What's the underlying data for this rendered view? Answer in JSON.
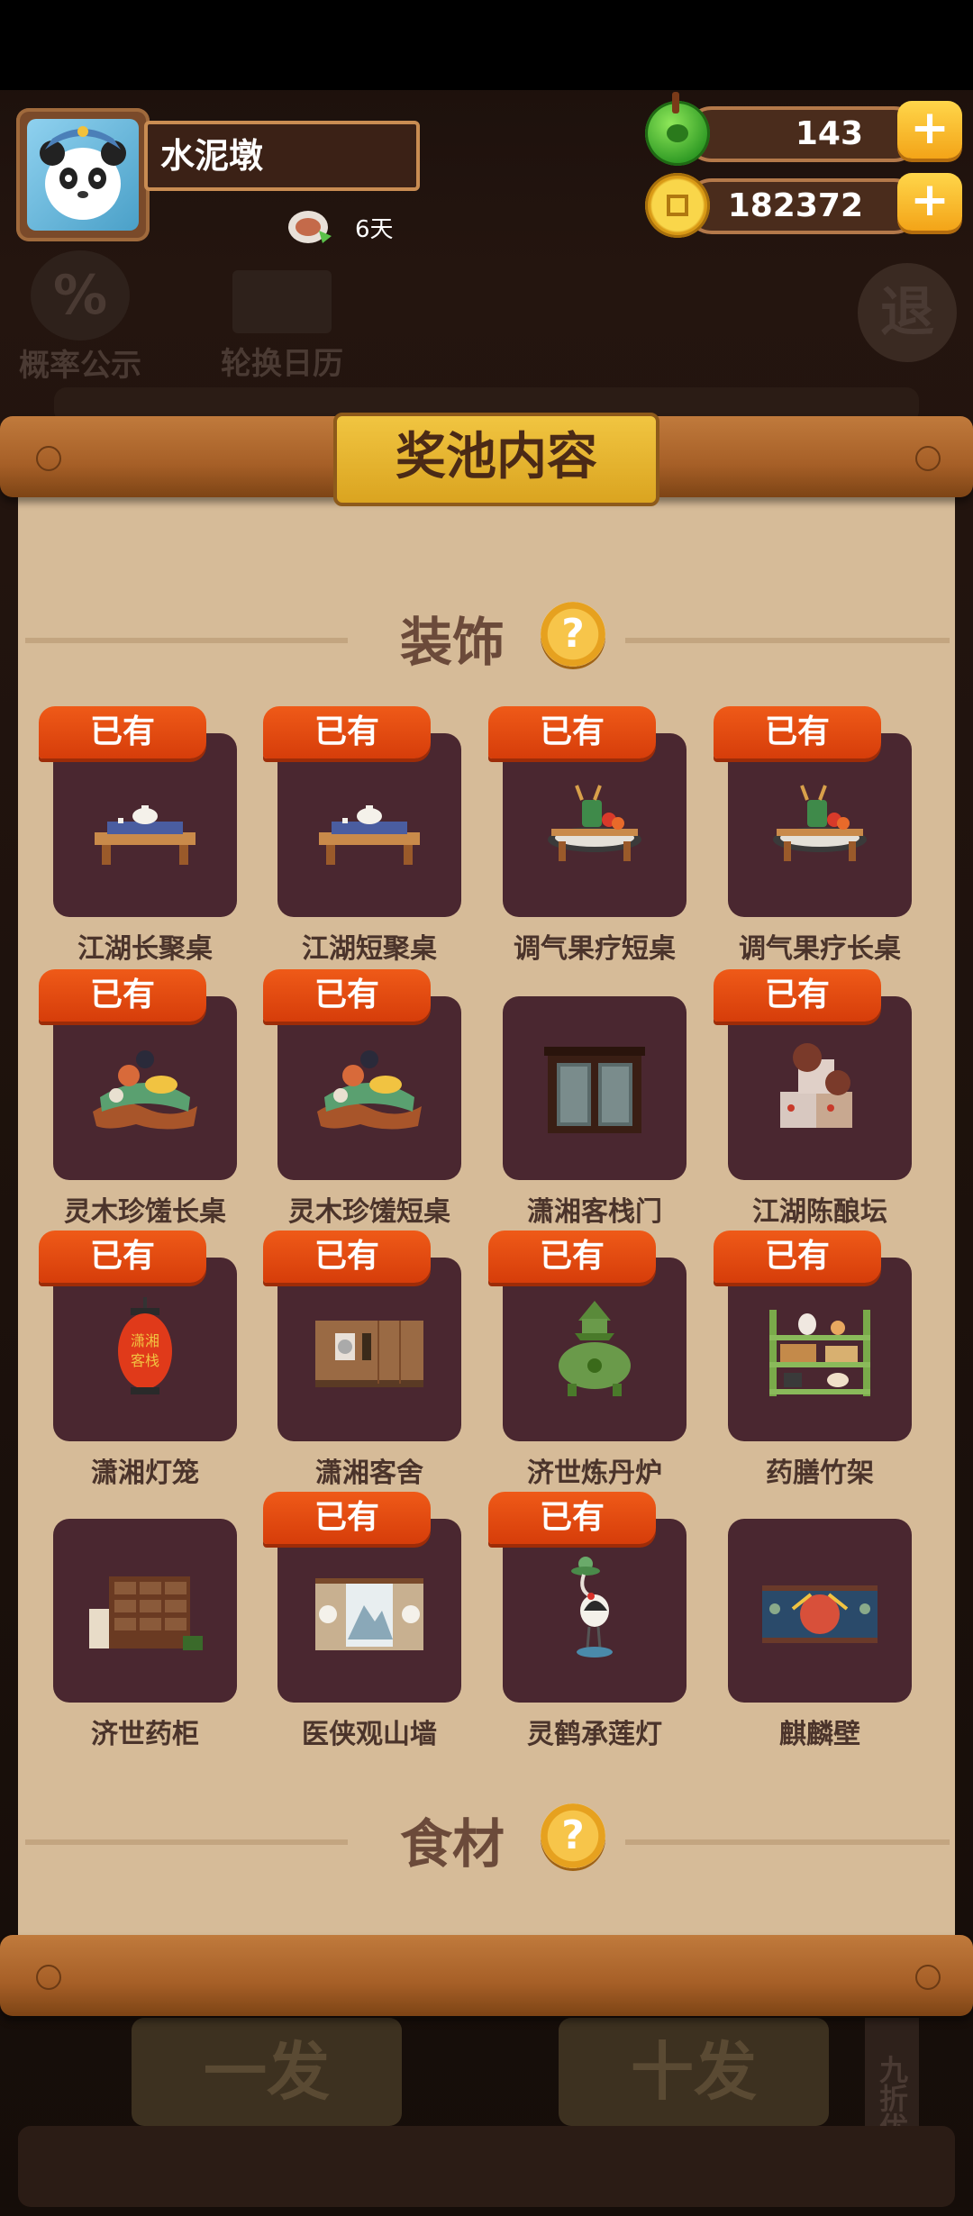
{
  "header": {
    "player_name": "水泥墩",
    "days": "6天",
    "jade": "143",
    "coins": "182372"
  },
  "background": {
    "prob_button": "概率公示",
    "calendar_button": "轮换日历",
    "exit_button": "退",
    "draw_one": "一发",
    "draw_ten": "十发",
    "discount": "九折优惠"
  },
  "panel": {
    "title": "奖池内容",
    "owned_label": "已有",
    "sections": [
      {
        "title": "装饰",
        "items": [
          {
            "name": "江湖长聚桌",
            "owned": true,
            "icon": "table-teapot-icon"
          },
          {
            "name": "江湖短聚桌",
            "owned": true,
            "icon": "table-teapot-icon"
          },
          {
            "name": "调气果疗短桌",
            "owned": true,
            "icon": "fruit-table-icon"
          },
          {
            "name": "调气果疗长桌",
            "owned": true,
            "icon": "fruit-table-icon"
          },
          {
            "name": "灵木珍馐长桌",
            "owned": true,
            "icon": "root-table-icon"
          },
          {
            "name": "灵木珍馐短桌",
            "owned": true,
            "icon": "root-table-icon"
          },
          {
            "name": "潇湘客栈门",
            "owned": false,
            "icon": "inn-door-icon"
          },
          {
            "name": "江湖陈酿坛",
            "owned": true,
            "icon": "wine-jars-icon"
          },
          {
            "name": "潇湘灯笼",
            "owned": true,
            "icon": "lantern-icon"
          },
          {
            "name": "潇湘客舍",
            "owned": true,
            "icon": "inn-room-icon"
          },
          {
            "name": "济世炼丹炉",
            "owned": true,
            "icon": "alchemy-furnace-icon"
          },
          {
            "name": "药膳竹架",
            "owned": true,
            "icon": "bamboo-shelf-icon"
          },
          {
            "name": "济世药柜",
            "owned": false,
            "icon": "medicine-cabinet-icon"
          },
          {
            "name": "医侠观山墙",
            "owned": true,
            "icon": "mountain-wall-icon"
          },
          {
            "name": "灵鹤承莲灯",
            "owned": true,
            "icon": "crane-lamp-icon"
          },
          {
            "name": "麒麟壁",
            "owned": false,
            "icon": "qilin-wall-icon"
          }
        ]
      },
      {
        "title": "食材",
        "items": []
      }
    ]
  },
  "colors": {
    "owned_badge": "#e54a12",
    "card_bg": "#4a2730",
    "paper": "#d6bb98",
    "title_plate": "#e8b530"
  }
}
